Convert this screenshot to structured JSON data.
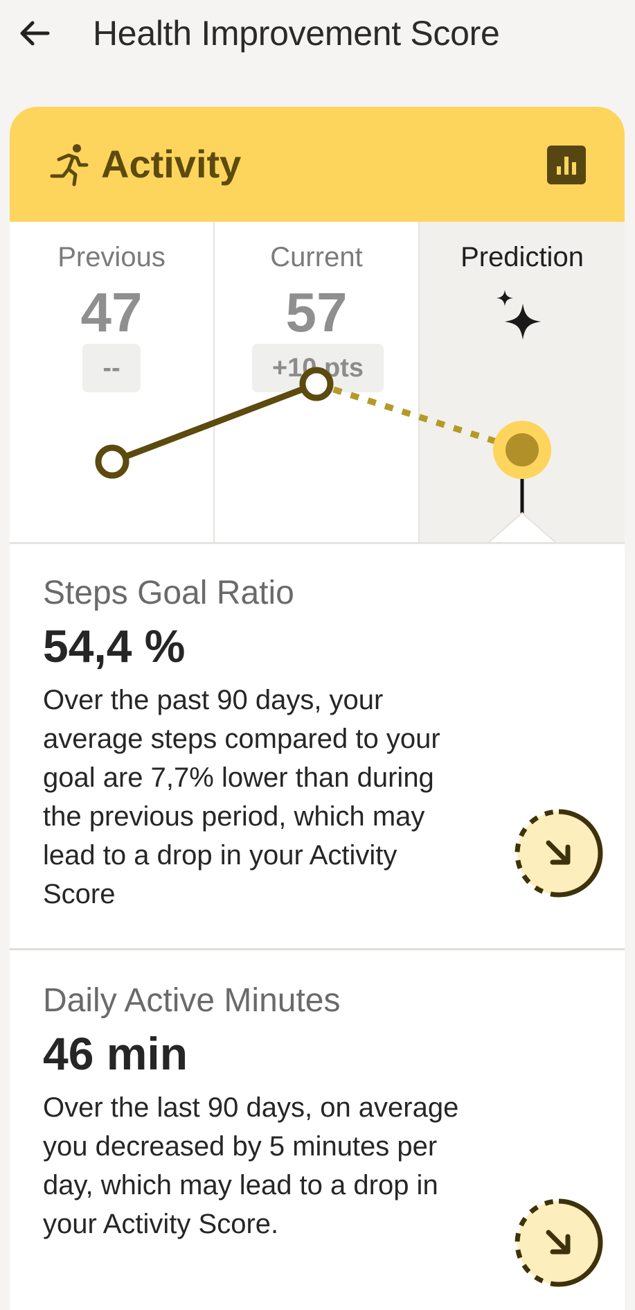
{
  "header": {
    "title": "Health Improvement Score",
    "back_icon": "arrow-left-icon"
  },
  "card": {
    "title": "Activity",
    "icon": "running-person-icon",
    "chart_button_icon": "bar-chart-icon",
    "accent_color": "#fdd55c",
    "dark_accent": "#5c4a0e"
  },
  "columns": {
    "previous": {
      "label": "Previous",
      "value": "47",
      "change": "--"
    },
    "current": {
      "label": "Current",
      "value": "57",
      "change": "+10  pts"
    },
    "prediction": {
      "label": "Prediction",
      "icon": "sparkle-icon"
    }
  },
  "metrics": [
    {
      "name": "Steps Goal Ratio",
      "value": "54,4 %",
      "description": "Over the past 90 days, your average steps compared to your goal are 7,7% lower than during the previous period, which may lead to a drop in your Activity Score",
      "trend_icon": "trend-down-arrow-icon"
    },
    {
      "name": "Daily Active Minutes",
      "value": "46 min",
      "description": "Over the last 90 days, on average you decreased by 5 minutes per day, which may lead to a drop in your Activity Score.",
      "trend_icon": "trend-down-arrow-icon"
    }
  ]
}
